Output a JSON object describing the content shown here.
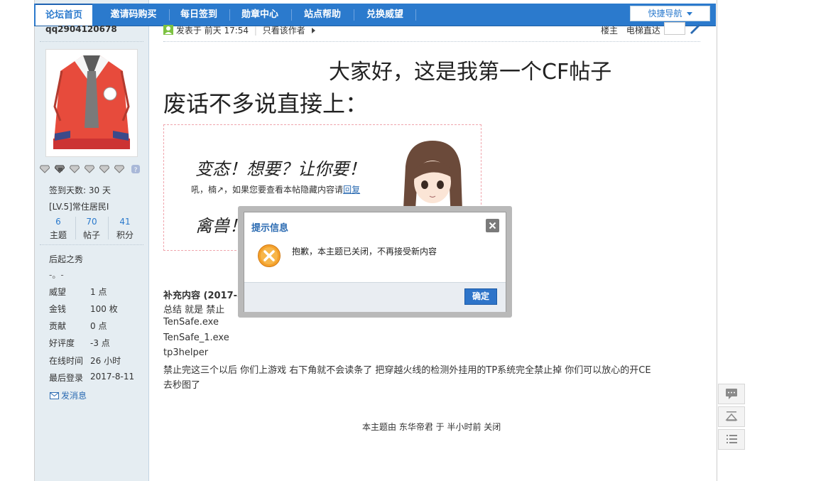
{
  "nav": {
    "tabs": [
      "论坛首页",
      "邀请码购买",
      "每日签到",
      "勋章中心",
      "站点帮助",
      "兑换威望"
    ],
    "active_index": 0,
    "quick_nav_label": "快捷导航",
    "colors": {
      "bar": "#2b7acd",
      "active_text": "#2b7acd"
    }
  },
  "author": {
    "username": "qq2904120678",
    "signin_days": "签到天数: 30 天",
    "rank": "[LV.5]常住居民I",
    "counts": [
      {
        "value": "6",
        "label": "主题"
      },
      {
        "value": "70",
        "label": "帖子"
      },
      {
        "value": "41",
        "label": "积分"
      }
    ],
    "group_title": "后起之秀",
    "group_note": "-。-",
    "details": [
      {
        "label": "威望",
        "value": "1 点"
      },
      {
        "label": "金钱",
        "value": "100 枚"
      },
      {
        "label": "贡献",
        "value": "0 点"
      },
      {
        "label": "好评度",
        "value": "-3 点"
      },
      {
        "label": "在线时间",
        "value": "26 小时"
      },
      {
        "label": "最后登录",
        "value": "2017-8-11"
      }
    ],
    "send_pm": "发消息",
    "medal_icons": [
      "diamond-icon",
      "diamond-icon",
      "diamond-icon",
      "diamond-icon",
      "diamond-icon",
      "diamond-icon",
      "question-icon"
    ]
  },
  "post": {
    "posted_prefix": "发表于",
    "posted_time": "前天 17:54",
    "only_author": "只看该作者",
    "floor": "楼主",
    "elevator": "电梯直达",
    "title_line": "大家好，这是我第一个CF帖子",
    "intro_line": "废话不多说直接上：",
    "hidden_box": {
      "big_line1": "变态！想要？让你要！",
      "small_prefix": "吼，楠↗，如果您要查看本帖隐藏内容请",
      "small_link": "回复",
      "big_line2": "禽兽！"
    },
    "supplement_label": "补充内容 (2017-8",
    "lines": [
      "总结  就是 禁止",
      "TenSafe.exe",
      "TenSafe_1.exe",
      "tp3helper",
      "禁止完这三个以后 你们上游戏  右下角就不会读条了  把穿越火线的检测外挂用的TP系统完全禁止掉  你们可以放心的开CE",
      "去秒图了"
    ],
    "closed_note": "本主题由 东华帝君 于 半小时前 关闭"
  },
  "modal": {
    "title": "提示信息",
    "message": "抱歉，本主题已关闭，不再接受新内容",
    "ok_label": "确定",
    "icon": "error-x-icon"
  },
  "tools": [
    "comment-icon",
    "back-to-top-icon",
    "list-icon"
  ]
}
